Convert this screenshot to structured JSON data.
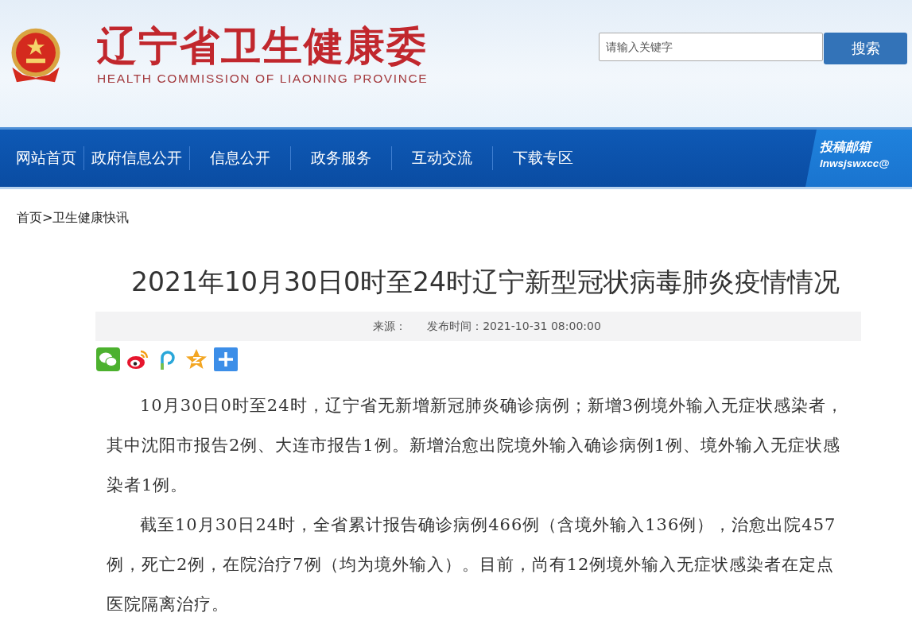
{
  "header": {
    "title": "辽宁省卫生健康委",
    "subtitle": "HEALTH COMMISSION OF LIAONING PROVINCE",
    "search": {
      "placeholder": "请输入关键字",
      "button": "搜索"
    }
  },
  "nav": {
    "items": [
      {
        "label": "网站首页"
      },
      {
        "label": "政府信息公开"
      },
      {
        "label": "信息公开"
      },
      {
        "label": "政务服务"
      },
      {
        "label": "互动交流"
      },
      {
        "label": "下载专区"
      }
    ],
    "mailbox": {
      "label": "投稿邮箱",
      "address": "lnwsjswxcc@"
    }
  },
  "breadcrumb": {
    "items": [
      "首页",
      "卫生健康快讯"
    ],
    "separator": ">"
  },
  "article": {
    "title": "2021年10月30日0时至24时辽宁新型冠状病毒肺炎疫情情况",
    "source": "来源：",
    "published": "发布时间：2021-10-31 08:00:00",
    "share": [
      {
        "kind": "chat"
      },
      {
        "kind": "eye"
      },
      {
        "kind": "hook"
      },
      {
        "kind": "star"
      },
      {
        "kind": "plus"
      }
    ],
    "paragraphs": [
      "10月30日0时至24时，辽宁省无新增新冠肺炎确诊病例；新增3例境外输入无症状感染者，其中沈阳市报告2例、大连市报告1例。新增治愈出院境外输入确诊病例1例、境外输入无症状感染者1例。",
      "截至10月30日24时，全省累计报告确诊病例466例（含境外输入136例），治愈出院457例，死亡2例，在院治疗7例（均为境外输入）。目前，尚有12例境外输入无症状感染者在定点医院隔离治疗。"
    ]
  }
}
